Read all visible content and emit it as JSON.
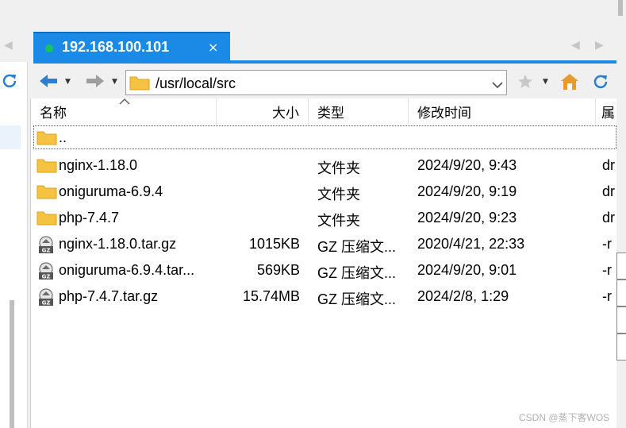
{
  "tab": {
    "title": "192.168.100.101",
    "close": "×",
    "status_color": "#19c35b"
  },
  "toolbar": {
    "path": "/usr/local/src",
    "back_icon": "back-arrow-icon",
    "forward_icon": "forward-arrow-icon"
  },
  "columns": {
    "name": "名称",
    "size": "大小",
    "type": "类型",
    "modified": "修改时间",
    "attr": "属"
  },
  "parent_row": {
    "name": ".."
  },
  "rows": [
    {
      "name": "nginx-1.18.0",
      "size": "",
      "type": "文件夹",
      "modified": "2024/9/20, 9:43",
      "attr": "dr",
      "icon": "folder-icon"
    },
    {
      "name": "oniguruma-6.9.4",
      "size": "",
      "type": "文件夹",
      "modified": "2024/9/20, 9:19",
      "attr": "dr",
      "icon": "folder-icon"
    },
    {
      "name": "php-7.4.7",
      "size": "",
      "type": "文件夹",
      "modified": "2024/9/20, 9:23",
      "attr": "dr",
      "icon": "folder-icon"
    },
    {
      "name": "nginx-1.18.0.tar.gz",
      "size": "1015KB",
      "type": "GZ 压缩文...",
      "modified": "2020/4/21, 22:33",
      "attr": "-r",
      "icon": "gz-archive-icon"
    },
    {
      "name": "oniguruma-6.9.4.tar...",
      "size": "569KB",
      "type": "GZ 压缩文...",
      "modified": "2024/9/20, 9:01",
      "attr": "-r",
      "icon": "gz-archive-icon"
    },
    {
      "name": "php-7.4.7.tar.gz",
      "size": "15.74MB",
      "type": "GZ 压缩文...",
      "modified": "2024/2/8, 1:29",
      "attr": "-r",
      "icon": "gz-archive-icon"
    }
  ],
  "watermark": "CSDN @蒸下客WOS",
  "colors": {
    "tab": "#1a8ae6",
    "folder": "#f5c244",
    "accent": "#2a7fd4"
  }
}
